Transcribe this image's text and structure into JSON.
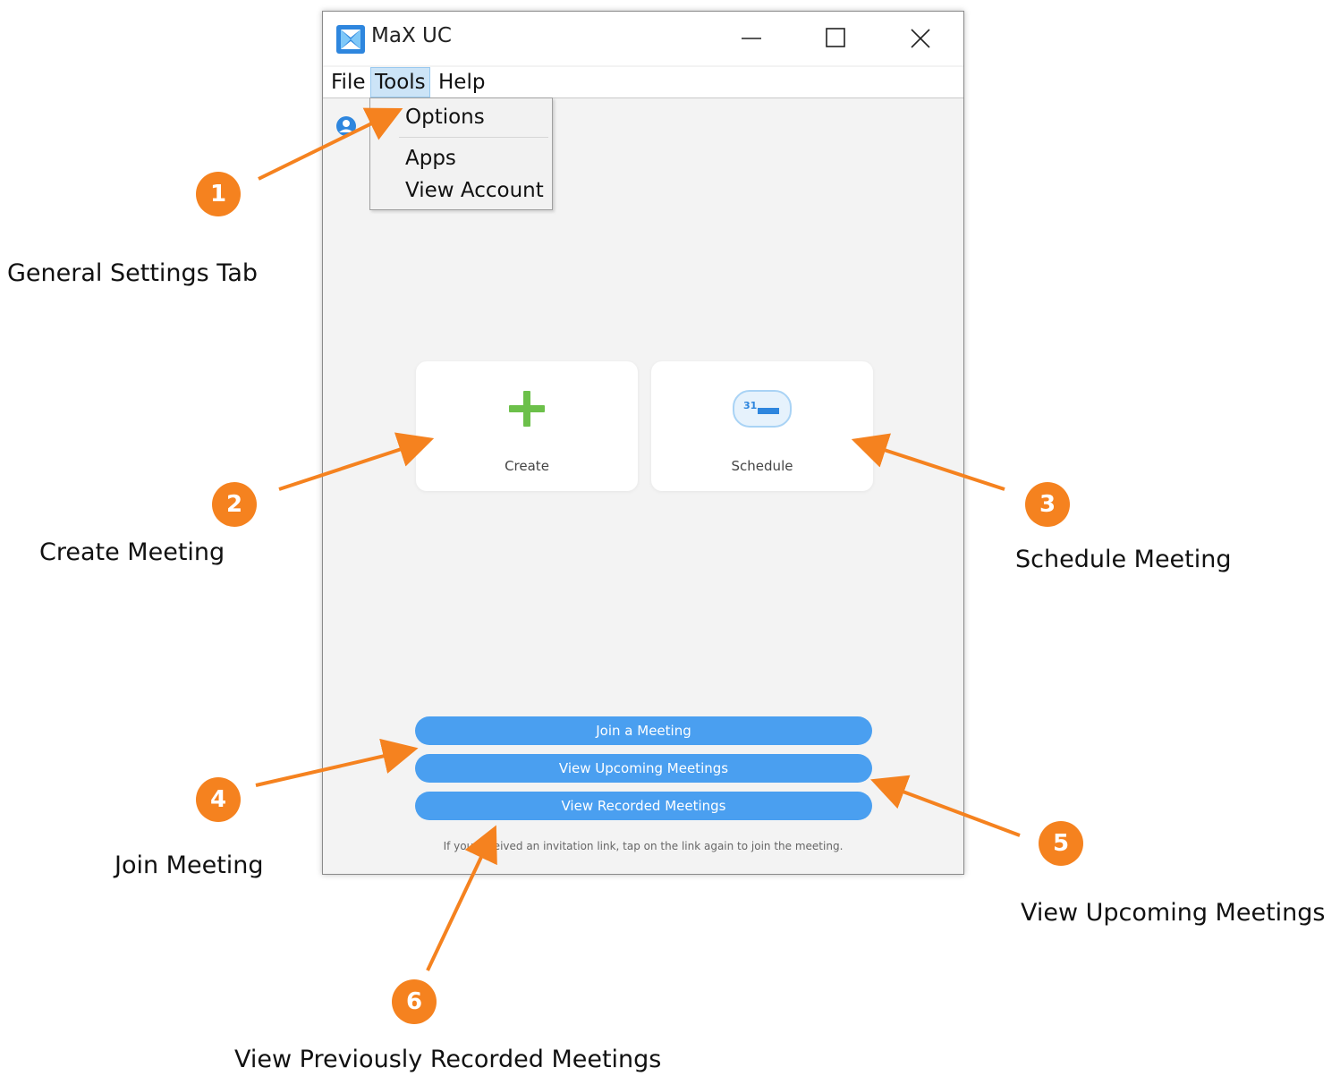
{
  "window": {
    "title": "MaX UC",
    "menu": {
      "file": "File",
      "tools": "Tools",
      "help": "Help"
    },
    "tools_dropdown": {
      "options": "Options",
      "apps": "Apps",
      "view_account": "View Account"
    },
    "cards": {
      "create": "Create",
      "schedule": "Schedule",
      "calendar_day": "31"
    },
    "buttons": {
      "join": "Join a Meeting",
      "upcoming": "View Upcoming Meetings",
      "recorded": "View Recorded Meetings"
    },
    "hint": "If you received an invitation link, tap on the link again to join the meeting."
  },
  "callouts": [
    {
      "number": "1",
      "label": "General Settings Tab"
    },
    {
      "number": "2",
      "label": "Create Meeting"
    },
    {
      "number": "3",
      "label": "Schedule Meeting"
    },
    {
      "number": "4",
      "label": "Join Meeting"
    },
    {
      "number": "5",
      "label": "View Upcoming Meetings"
    },
    {
      "number": "6",
      "label": "View Previously Recorded Meetings"
    }
  ],
  "colors": {
    "accent_orange": "#f5821f",
    "button_blue": "#4a9ff0",
    "create_green": "#6cc04a"
  }
}
